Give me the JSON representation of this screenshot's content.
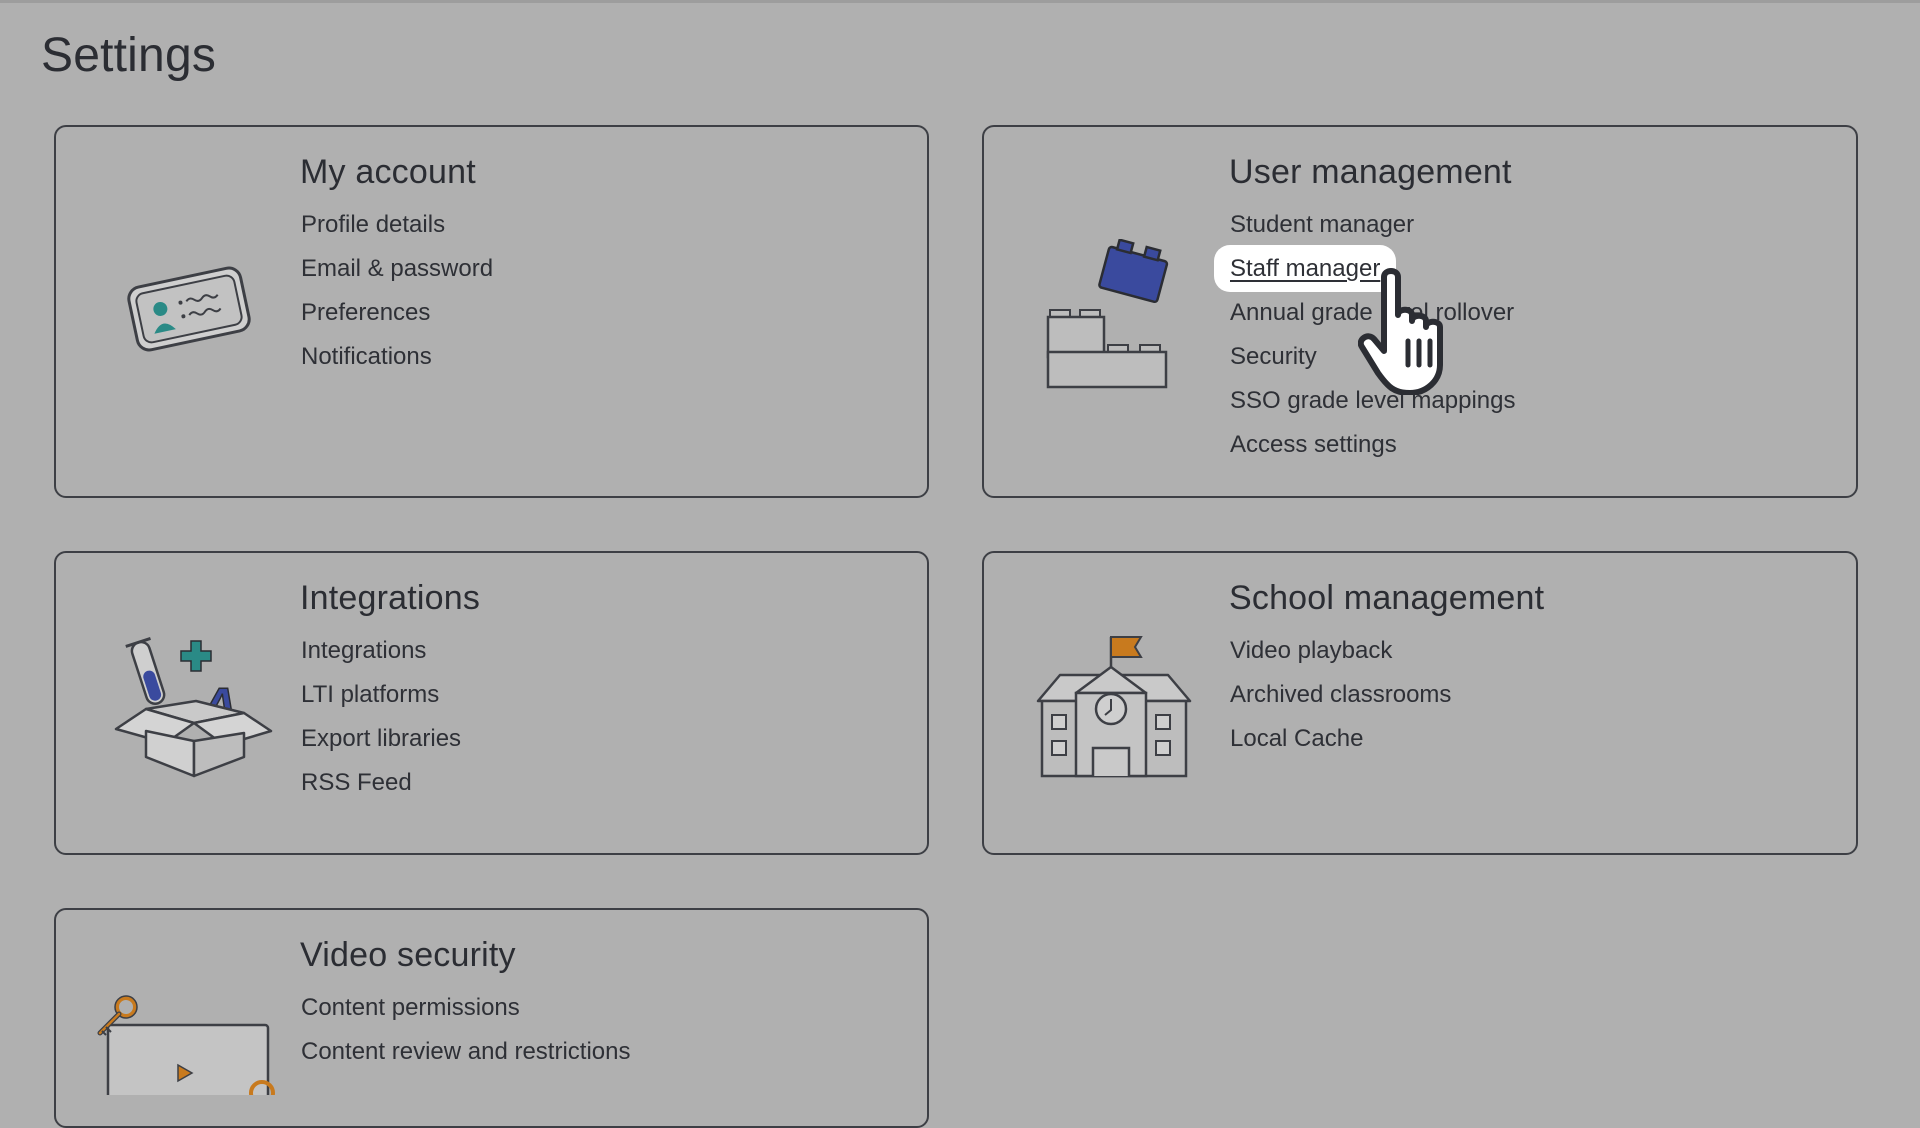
{
  "page": {
    "title": "Settings"
  },
  "cards": {
    "my_account": {
      "title": "My account",
      "icon": "id-card-icon",
      "links": [
        "Profile details",
        "Email & password",
        "Preferences",
        "Notifications"
      ]
    },
    "user_management": {
      "title": "User management",
      "icon": "building-blocks-icon",
      "links": [
        "Student manager",
        "Staff manager",
        "Annual grade level rollover",
        "Security",
        "SSO grade level mappings",
        "Access settings"
      ],
      "active_link": "Staff manager"
    },
    "integrations": {
      "title": "Integrations",
      "icon": "science-box-icon",
      "links": [
        "Integrations",
        "LTI platforms",
        "Export libraries",
        "RSS Feed"
      ]
    },
    "school_management": {
      "title": "School management",
      "icon": "school-building-icon",
      "links": [
        "Video playback",
        "Archived classrooms",
        "Local Cache"
      ]
    },
    "video_security": {
      "title": "Video security",
      "icon": "video-key-icon",
      "links": [
        "Content permissions",
        "Content review and restrictions"
      ]
    }
  },
  "cursor": {
    "icon": "pointer-hand-icon"
  },
  "colors": {
    "background": "#b0b0b0",
    "border": "#3d3f45",
    "text": "#2b2d33",
    "teal": "#2a8a86",
    "blue": "#3a4a9e",
    "orange": "#c87a1e",
    "highlight": "#ffffff"
  }
}
